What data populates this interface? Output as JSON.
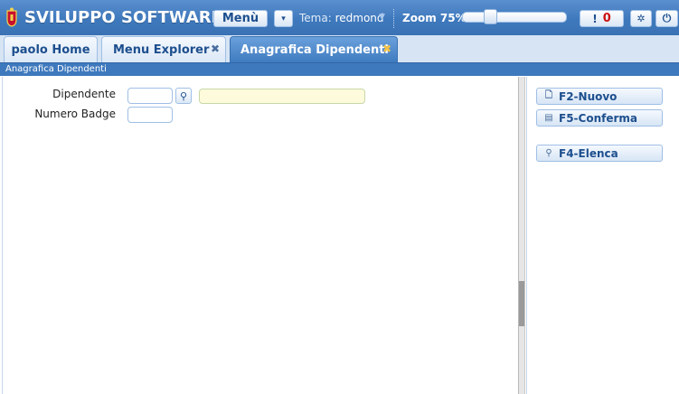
{
  "header": {
    "app_title": "SVILUPPO SOFTWARE",
    "menu_label": "Menù",
    "theme_label": "Tema:",
    "theme_value": "redmond",
    "zoom_label": "Zoom 75%",
    "zoom_level_percent": 75,
    "alerts_count": "0",
    "alerts_mark": "!"
  },
  "tabs": [
    {
      "label": "paolo Home",
      "closable": false
    },
    {
      "label": "Menu Explorer",
      "closable": true
    },
    {
      "label": "Anagrafica Dipendenti",
      "closable": true,
      "active": true
    }
  ],
  "panel": {
    "title": "Anagrafica Dipendenti"
  },
  "form": {
    "dipendente_label": "Dipendente",
    "dipendente_value": "",
    "dipendente_description": "",
    "badge_label": "Numero Badge",
    "badge_value": ""
  },
  "actions": {
    "nuovo": "F2-Nuovo",
    "conferma": "F5-Conferma",
    "elenca": "F4-Elenca"
  },
  "colors": {
    "header_bg": "#3f79bd",
    "active_tab": "#3f7bc0",
    "readonly_field": "#fdfbdc",
    "alert_count": "#cc1111"
  },
  "icons": [
    "logo-icon",
    "chevron-down-icon",
    "gear-icon",
    "power-icon",
    "close-icon",
    "search-icon",
    "new-doc-icon",
    "save-icon"
  ]
}
